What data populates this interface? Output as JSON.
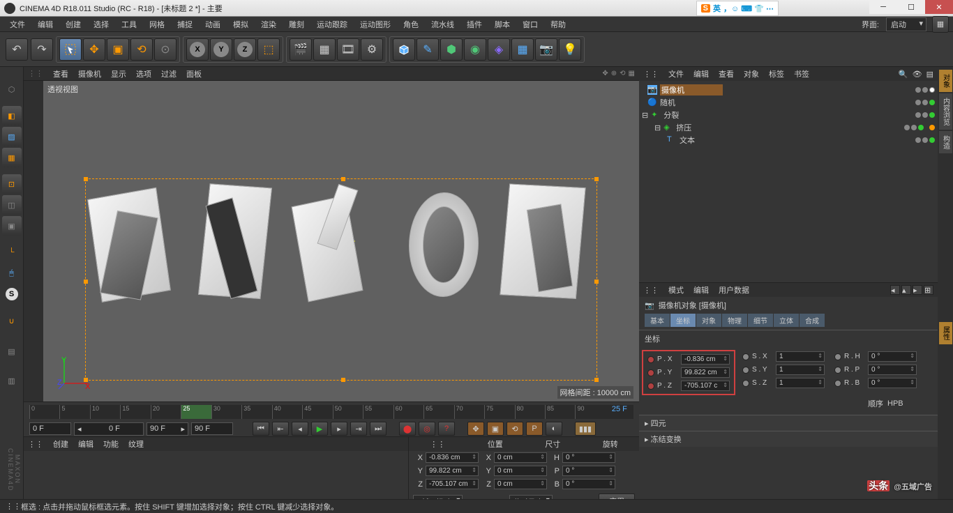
{
  "title": "CINEMA 4D R18.011 Studio (RC - R18) - [未标题 2 *] - 主要",
  "ime": {
    "s": "S",
    "lang": "英"
  },
  "menubar": [
    "文件",
    "编辑",
    "创建",
    "选择",
    "工具",
    "网格",
    "捕捉",
    "动画",
    "模拟",
    "渲染",
    "雕刻",
    "运动跟踪",
    "运动图形",
    "角色",
    "流水线",
    "插件",
    "脚本",
    "窗口",
    "帮助"
  ],
  "ui_label": "界面:",
  "ui_value": "启动",
  "viewport_tabs": [
    "查看",
    "摄像机",
    "显示",
    "选项",
    "过滤",
    "面板"
  ],
  "viewport_title": "透视视图",
  "grid_distance": "网格间距 : 10000 cm",
  "timeline": {
    "ticks": [
      "0",
      "5",
      "10",
      "15",
      "20",
      "25",
      "30",
      "35",
      "40",
      "45",
      "50",
      "55",
      "60",
      "65",
      "70",
      "75",
      "80",
      "85",
      "90"
    ],
    "current": "25",
    "start": "0 F",
    "cur": "0 F",
    "end": "90 F",
    "end2": "90 F",
    "right": "25 F"
  },
  "mat_tabs": [
    "创建",
    "编辑",
    "功能",
    "纹理"
  ],
  "coord_headers": [
    "位置",
    "尺寸",
    "旋转"
  ],
  "coord": {
    "x": {
      "p": "-0.836 cm",
      "s": "0 cm",
      "r": "0 °"
    },
    "y": {
      "p": "99.822 cm",
      "s": "0 cm",
      "r": "0 °"
    },
    "z": {
      "p": "-705.107 cm",
      "s": "0 cm",
      "r": "0 °"
    }
  },
  "coord_rel": "对象 (相对)",
  "coord_abs": "绝对尺寸",
  "coord_apply": "应用",
  "obj_tabs": [
    "文件",
    "编辑",
    "查看",
    "对象",
    "标签",
    "书签"
  ],
  "obj_tree": [
    {
      "name": "摄像机",
      "indent": 0,
      "sel": true,
      "ico": "#5ab0ff"
    },
    {
      "name": "随机",
      "indent": 0,
      "ico": "#5ab0ff"
    },
    {
      "name": "分裂",
      "indent": 0,
      "ico": "#50c878"
    },
    {
      "name": "挤压",
      "indent": 1,
      "ico": "#50c878",
      "extra": true
    },
    {
      "name": "文本",
      "indent": 2,
      "ico": "#5ab0ff"
    }
  ],
  "attr_tabs": [
    "模式",
    "编辑",
    "用户数据"
  ],
  "attr_obj": "摄像机对象 [摄像机]",
  "attr_subtabs": [
    "基本",
    "坐标",
    "对象",
    "物理",
    "细节",
    "立体",
    "合成"
  ],
  "attr_subtab_active": 1,
  "attr_section": "坐标",
  "attr_coords": {
    "rows": [
      {
        "l1": "P . X",
        "v1": "-0.836 cm",
        "l2": "S . X",
        "v2": "1",
        "l3": "R . H",
        "v3": "0 °"
      },
      {
        "l1": "P . Y",
        "v1": "99.822 cm",
        "l2": "S . Y",
        "v2": "1",
        "l3": "R . P",
        "v3": "0 °"
      },
      {
        "l1": "P . Z",
        "v1": "-705.107 c",
        "l2": "S . Z",
        "v2": "1",
        "l3": "R . B",
        "v3": "0 °"
      }
    ],
    "order_lbl": "顺序",
    "order_val": "HPB"
  },
  "attr_folds": [
    "四元",
    "冻结变换"
  ],
  "sidetabs": [
    "对象",
    "内容浏览",
    "构造",
    "属性"
  ],
  "status": "框选 : 点击并拖动鼠标框选元素。按住 SHIFT 键增加选择对象；按住 CTRL 键减少选择对象。",
  "watermark": "头条 @五域广告",
  "vlogo": "MAXON CINEMA4D"
}
